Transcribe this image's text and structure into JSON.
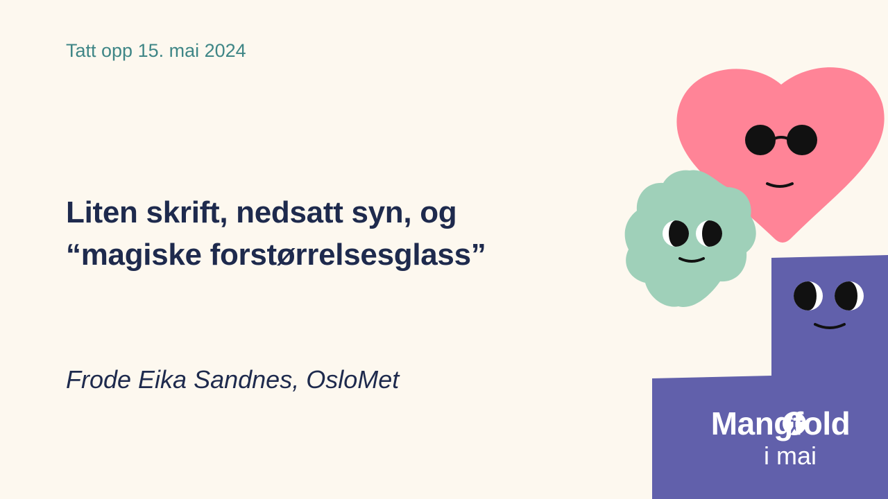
{
  "header": {
    "date_text": "Tatt opp 15. mai 2024"
  },
  "main": {
    "title_line1": "Liten skrift, nedsatt syn, og",
    "title_line2": "“magiske forstørrelsesglass”",
    "author": "Frode Eika Sandnes, OsloMet"
  },
  "brand": {
    "name": "Mangfold",
    "subtitle": "i mai"
  },
  "colors": {
    "background": "#fdf8ef",
    "heart": "#ff8497",
    "flower": "#9fd0b9",
    "block": "#6160ab",
    "text": "#1e2a4d",
    "date": "#3f8686"
  },
  "icons": [
    "heart-character-icon",
    "flower-character-icon",
    "block-character-icon",
    "accessibility-icon"
  ]
}
